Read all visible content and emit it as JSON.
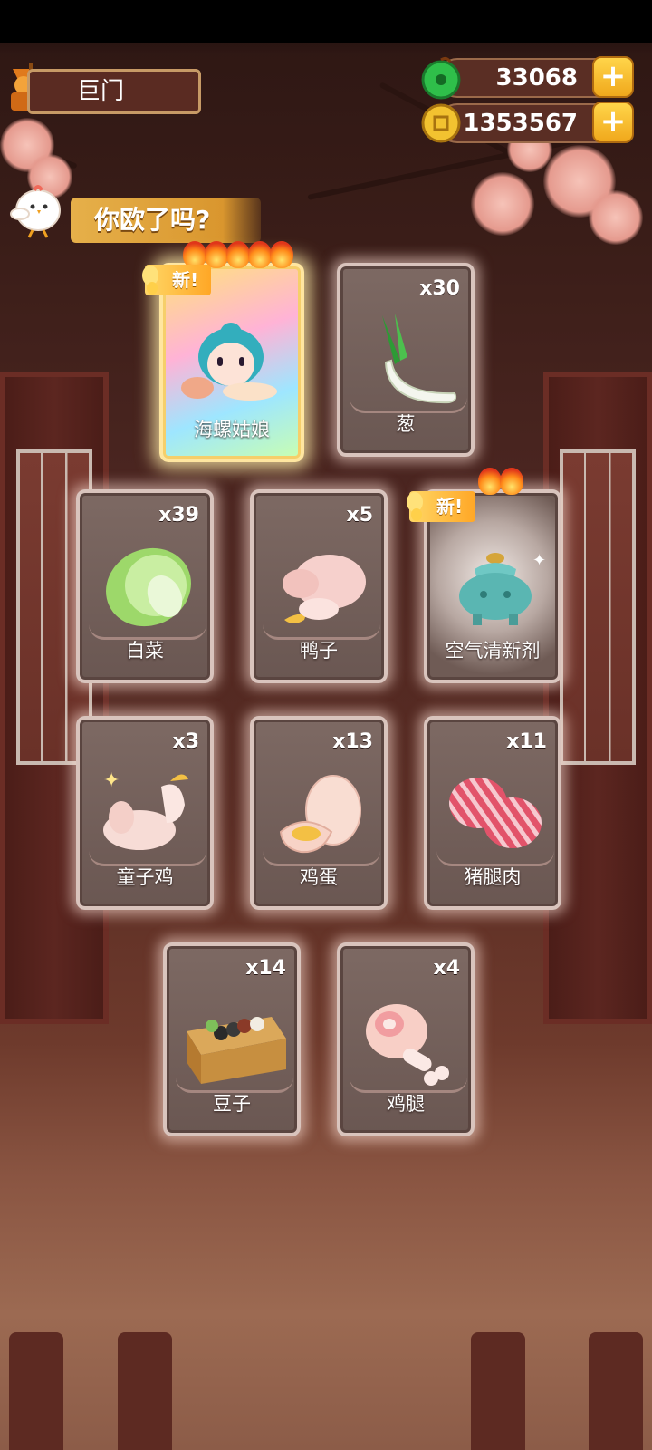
{
  "header": {
    "region_name": "巨门",
    "jade_amount": "33068",
    "coin_amount": "1353567",
    "plus_label": "+"
  },
  "banner": {
    "text": "你欧了吗?"
  },
  "new_label": "新!",
  "cards": [
    {
      "name": "海螺姑娘",
      "qty": "",
      "icon": "snail-girl-character-icon",
      "is_new": true,
      "stars": 5,
      "rarity": "gold"
    },
    {
      "name": "葱",
      "qty": "x30",
      "icon": "scallion-icon"
    },
    {
      "name": "白菜",
      "qty": "x39",
      "icon": "cabbage-icon"
    },
    {
      "name": "鸭子",
      "qty": "x5",
      "icon": "duck-icon"
    },
    {
      "name": "空气清新剂",
      "qty": "",
      "icon": "incense-burner-icon",
      "is_new": true,
      "stars": 2
    },
    {
      "name": "童子鸡",
      "qty": "x3",
      "icon": "chicken-icon"
    },
    {
      "name": "鸡蛋",
      "qty": "x13",
      "icon": "egg-icon"
    },
    {
      "name": "猪腿肉",
      "qty": "x11",
      "icon": "pork-icon"
    },
    {
      "name": "豆子",
      "qty": "x14",
      "icon": "beans-box-icon"
    },
    {
      "name": "鸡腿",
      "qty": "x4",
      "icon": "drumstick-icon"
    }
  ],
  "colors": {
    "gold_accent": "#f0a81c",
    "card_border": "#d9c4bd",
    "jade": "#2fbf4a"
  }
}
